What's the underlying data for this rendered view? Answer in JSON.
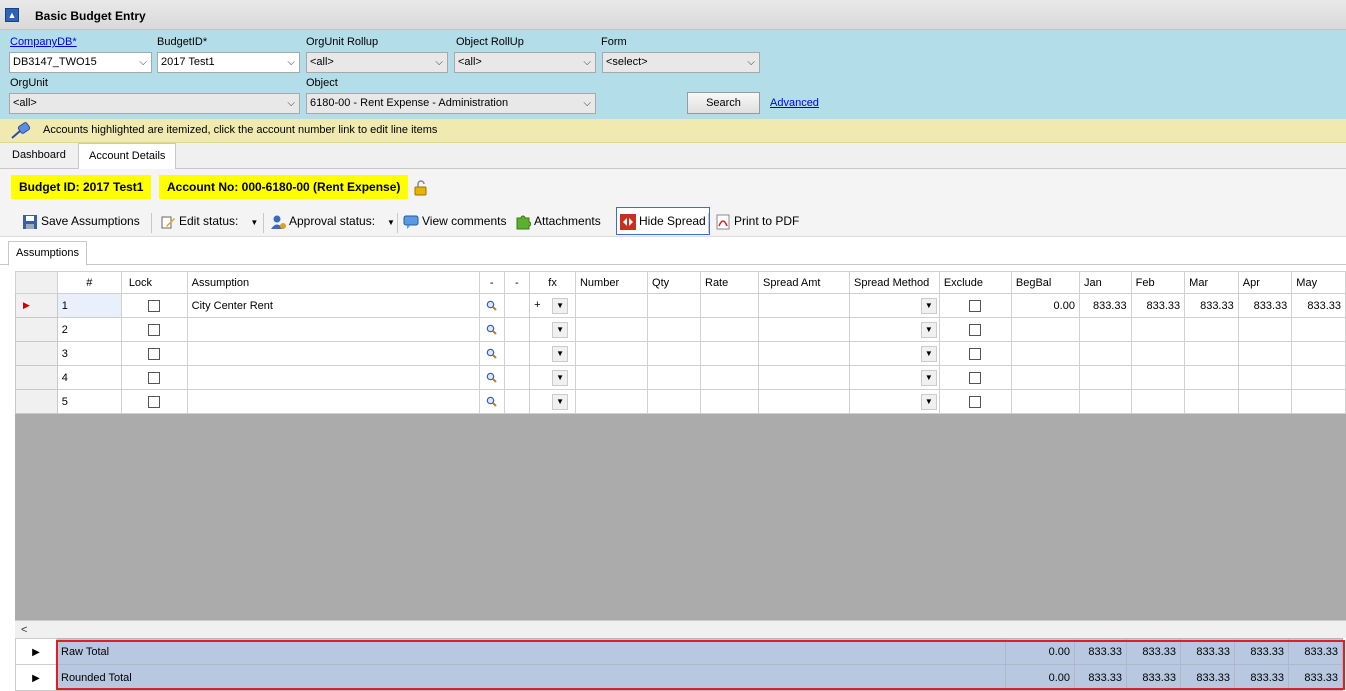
{
  "window": {
    "title": "Basic Budget Entry"
  },
  "filters": {
    "companydb_label": "CompanyDB*",
    "companydb_value": "DB3147_TWO15",
    "budgetid_label": "BudgetID*",
    "budgetid_value": "2017 Test1",
    "orgunit_rollup_label": "OrgUnit Rollup",
    "orgunit_rollup_value": "<all>",
    "object_rollup_label": "Object RollUp",
    "object_rollup_value": "<all>",
    "form_label": "Form",
    "form_value": "<select>",
    "orgunit_label": "OrgUnit",
    "orgunit_value": "<all>",
    "object_label": "Object",
    "object_value": "6180-00 - Rent Expense - Administration",
    "search_label": "Search",
    "advanced_label": "Advanced"
  },
  "notice": {
    "text": "Accounts highlighted are itemized, click the account number link to edit line items"
  },
  "tabs": [
    "Dashboard",
    "Account Details"
  ],
  "budget_bar": {
    "budget_id": "Budget ID: 2017 Test1",
    "account_no": "Account No: 000-6180-00 (Rent Expense)"
  },
  "toolbar": {
    "save": "Save Assumptions",
    "edit_status": "Edit status:",
    "approval_status": "Approval status:",
    "view_comments": "View comments",
    "attachments": "Attachments",
    "hide_spread": "Hide Spread",
    "print_pdf": "Print to PDF"
  },
  "subtab": "Assumptions",
  "grid": {
    "columns": [
      "#",
      "Lock",
      "Assumption",
      "-",
      "-",
      "fx",
      "Number",
      "Qty",
      "Rate",
      "Spread Amt",
      "Spread Method",
      "Exclude",
      "BegBal",
      "Jan",
      "Feb",
      "Mar",
      "Apr",
      "May"
    ],
    "rows": [
      {
        "num": "1",
        "assumption": "City Center Rent",
        "fx": "+",
        "begbal": "0.00",
        "months": [
          "833.33",
          "833.33",
          "833.33",
          "833.33",
          "833.33"
        ]
      },
      {
        "num": "2",
        "assumption": "",
        "fx": "",
        "begbal": "",
        "months": [
          "",
          "",
          "",
          "",
          ""
        ]
      },
      {
        "num": "3",
        "assumption": "",
        "fx": "",
        "begbal": "",
        "months": [
          "",
          "",
          "",
          "",
          ""
        ]
      },
      {
        "num": "4",
        "assumption": "",
        "fx": "",
        "begbal": "",
        "months": [
          "",
          "",
          "",
          "",
          ""
        ]
      },
      {
        "num": "5",
        "assumption": "",
        "fx": "",
        "begbal": "",
        "months": [
          "",
          "",
          "",
          "",
          ""
        ]
      }
    ]
  },
  "totals": [
    {
      "label": "Raw Total",
      "begbal": "0.00",
      "months": [
        "833.33",
        "833.33",
        "833.33",
        "833.33",
        "833.33"
      ]
    },
    {
      "label": "Rounded Total",
      "begbal": "0.00",
      "months": [
        "833.33",
        "833.33",
        "833.33",
        "833.33",
        "833.33"
      ]
    }
  ],
  "colors": {
    "filter_bg": "#b3dde8",
    "highlight": "#ffff00",
    "notice_bg": "#f0eab0",
    "total_bg": "#b8c8e0",
    "outline_red": "#e02020"
  }
}
